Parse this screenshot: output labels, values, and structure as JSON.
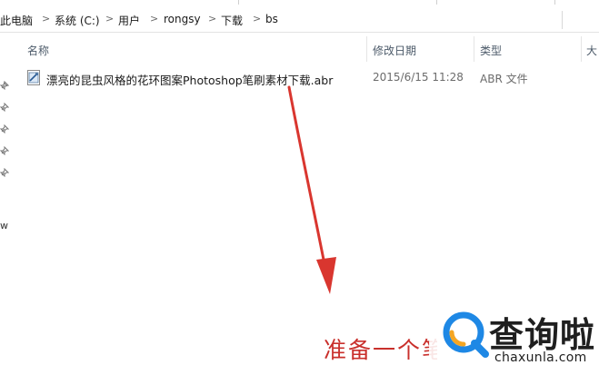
{
  "breadcrumb": [
    {
      "label": "此电脑"
    },
    {
      "label": "系统 (C:)"
    },
    {
      "label": "用户"
    },
    {
      "label": "rongsy"
    },
    {
      "label": "下载"
    },
    {
      "label": "bs"
    }
  ],
  "columns": {
    "name": "名称",
    "date_modified": "修改日期",
    "type": "类型",
    "size": "大"
  },
  "nav": {
    "partial_label": "w"
  },
  "files": [
    {
      "name": "漂亮的昆虫风格的花环图案Photoshop笔刷素材下载.abr",
      "date_modified": "2015/6/15 11:28",
      "type": "ABR 文件",
      "icon": "abr-file-icon"
    }
  ],
  "annotation": {
    "caption": "准备一个笔",
    "arrow_color": "#d9362f"
  },
  "watermark": {
    "brand": "查询啦",
    "url": "chaxunla.com",
    "accent_blue": "#1e88e5",
    "accent_orange": "#f5a623"
  }
}
